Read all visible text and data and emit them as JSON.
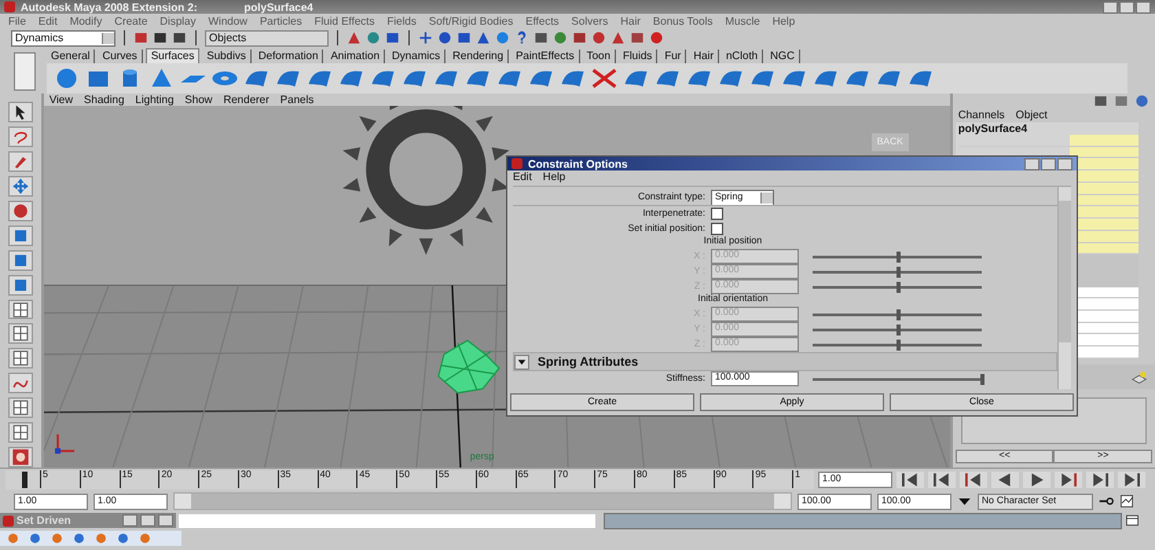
{
  "window": {
    "title": "Autodesk Maya 2008 Extension 2:",
    "object": "polySurface4"
  },
  "menu": [
    "File",
    "Edit",
    "Modify",
    "Create",
    "Display",
    "Window",
    "Particles",
    "Fluid Effects",
    "Fields",
    "Soft/Rigid Bodies",
    "Effects",
    "Solvers",
    "Hair",
    "Bonus Tools",
    "Muscle",
    "Help"
  ],
  "status_line": {
    "mode": "Dynamics",
    "selection_field": "Objects"
  },
  "shelf_tabs": [
    {
      "label": "General",
      "selected": false
    },
    {
      "label": "Curves",
      "selected": false
    },
    {
      "label": "Surfaces",
      "selected": true
    },
    {
      "label": "Subdivs",
      "selected": false
    },
    {
      "label": "Deformation",
      "selected": false
    },
    {
      "label": "Animation",
      "selected": false
    },
    {
      "label": "Dynamics",
      "selected": false
    },
    {
      "label": "Rendering",
      "selected": false
    },
    {
      "label": "PaintEffects",
      "selected": false
    },
    {
      "label": "Toon",
      "selected": false
    },
    {
      "label": "Fluids",
      "selected": false
    },
    {
      "label": "Fur",
      "selected": false
    },
    {
      "label": "Hair",
      "selected": false
    },
    {
      "label": "nCloth",
      "selected": false
    },
    {
      "label": "NGC",
      "selected": false
    }
  ],
  "panel_menu": [
    "View",
    "Shading",
    "Lighting",
    "Show",
    "Renderer",
    "Panels"
  ],
  "viewport": {
    "view_button": "BACK",
    "camera": "persp"
  },
  "dialog": {
    "title": "Constraint Options",
    "menu": [
      "Edit",
      "Help"
    ],
    "type_label": "Constraint type:",
    "type_value": "Spring",
    "checks": [
      {
        "label": "Interpenetrate:",
        "checked": false
      },
      {
        "label": "Set initial position:",
        "checked": false
      }
    ],
    "groups": [
      {
        "title": "Initial position",
        "rows": [
          {
            "axis": "X :",
            "value": "0.000",
            "level": 0.5,
            "disabled": true
          },
          {
            "axis": "Y :",
            "value": "0.000",
            "level": 0.5,
            "disabled": true
          },
          {
            "axis": "Z :",
            "value": "0.000",
            "level": 0.5,
            "disabled": true
          }
        ]
      },
      {
        "title": "Initial orientation",
        "rows": [
          {
            "axis": "X :",
            "value": "0.000",
            "level": 0.5,
            "disabled": true
          },
          {
            "axis": "Y :",
            "value": "0.000",
            "level": 0.5,
            "disabled": true
          },
          {
            "axis": "Z :",
            "value": "0.000",
            "level": 0.5,
            "disabled": true
          }
        ]
      }
    ],
    "section": {
      "title": "Spring Attributes",
      "expanded": true
    },
    "stiffness": {
      "label": "Stiffness:",
      "value": "100.000",
      "level": 1
    },
    "buttons": [
      "Create",
      "Apply",
      "Close"
    ]
  },
  "channel_box": {
    "tabs": [
      "Channels",
      "Object"
    ],
    "object": "polySurface4",
    "nav": [
      "<<",
      ">>"
    ]
  },
  "time_slider": {
    "ticks": [
      "5",
      "10",
      "15",
      "20",
      "25",
      "30",
      "35",
      "40",
      "45",
      "50",
      "55",
      "60",
      "65",
      "70",
      "75",
      "80",
      "85",
      "90",
      "95",
      "1"
    ],
    "current_frame": "1.00",
    "level": 0
  },
  "range_slider": {
    "start": "1.00",
    "inner_start": "1.00",
    "inner_end": "100.00",
    "end": "100.00",
    "character_set": "No Character Set",
    "level": 1
  },
  "command_line": {
    "panel_title": "Set Driven"
  }
}
